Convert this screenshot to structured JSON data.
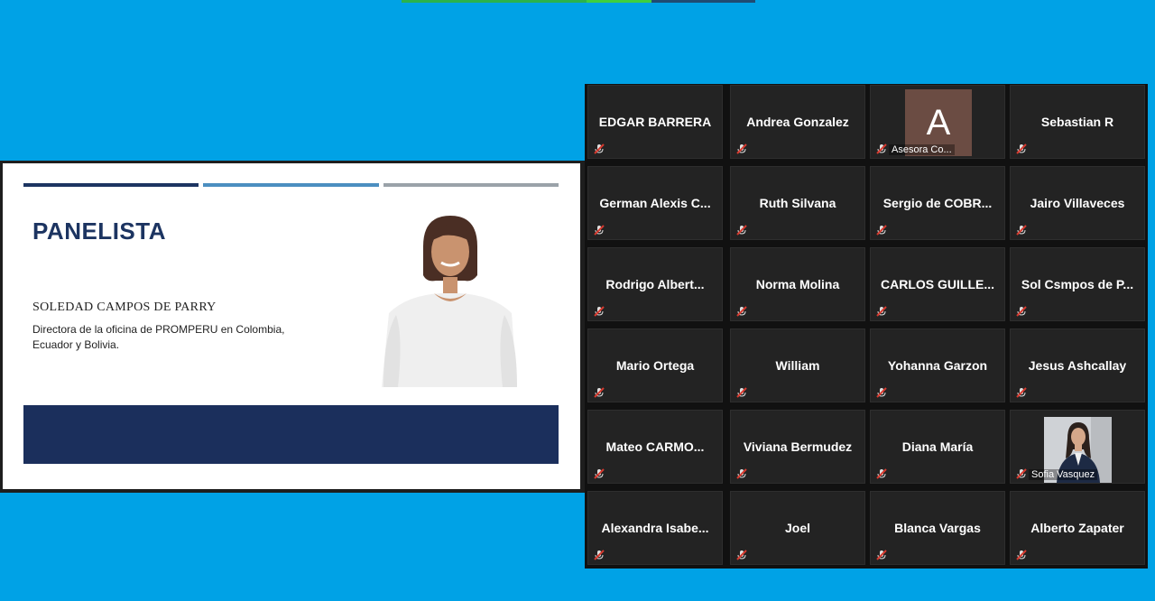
{
  "colors": {
    "background": "#00a2e6",
    "tile_bg": "#232323",
    "slide_title": "#1c3461",
    "mic_muted": "#d63a2f"
  },
  "slide": {
    "title": "PANELISTA",
    "speaker_name": "SOLEDAD CAMPOS DE PARRY",
    "speaker_role": "Directora de la oficina de PROMPERU en Colombia, Ecuador y Bolivia."
  },
  "participants": [
    {
      "name": "EDGAR BARRERA"
    },
    {
      "name": "Andrea Gonzalez"
    },
    {
      "name": "Asesora Co...",
      "avatar_letter": "A",
      "type": "avatar"
    },
    {
      "name": "Sebastian R"
    },
    {
      "name": "German Alexis C..."
    },
    {
      "name": "Ruth Silvana"
    },
    {
      "name": "Sergio de COBR..."
    },
    {
      "name": "Jairo Villaveces"
    },
    {
      "name": "Rodrigo Albert..."
    },
    {
      "name": "Norma Molina"
    },
    {
      "name": "CARLOS GUILLE..."
    },
    {
      "name": "Sol Csmpos de P..."
    },
    {
      "name": "Mario Ortega"
    },
    {
      "name": "William"
    },
    {
      "name": "Yohanna Garzon"
    },
    {
      "name": "Jesus Ashcallay"
    },
    {
      "name": "Mateo CARMO..."
    },
    {
      "name": "Viviana Bermudez"
    },
    {
      "name": "Diana María"
    },
    {
      "name": "Sofia Vasquez",
      "type": "video"
    },
    {
      "name": "Alexandra Isabe..."
    },
    {
      "name": "Joel"
    },
    {
      "name": "Blanca Vargas"
    },
    {
      "name": "Alberto Zapater"
    }
  ],
  "icons": {
    "mic": "mic-muted-icon"
  }
}
